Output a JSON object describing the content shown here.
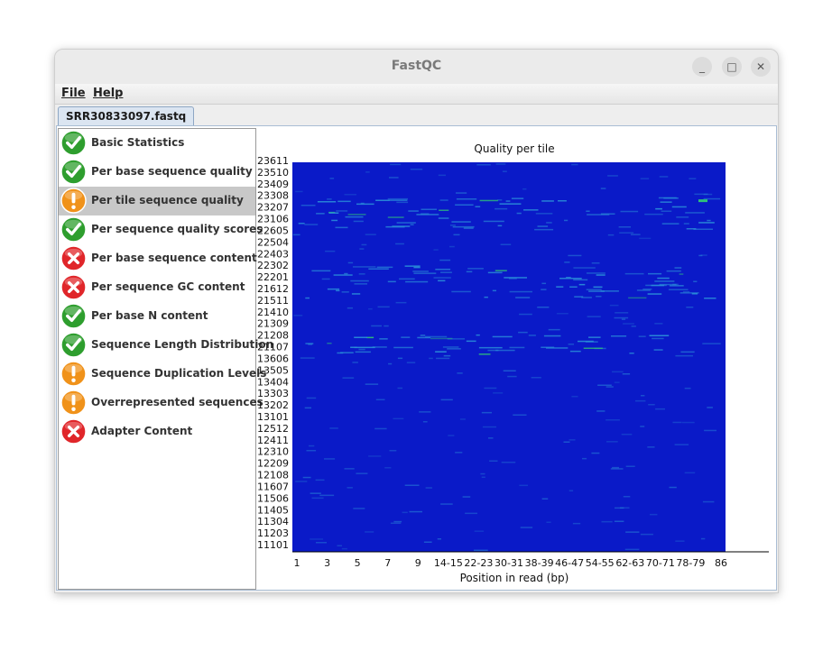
{
  "window": {
    "title": "FastQC",
    "controls": {
      "minimize": "_",
      "maximize": "□",
      "close": "✕"
    }
  },
  "menu": {
    "file": "File",
    "help": "Help"
  },
  "tab": {
    "label": "SRR30833097.fastq"
  },
  "modules": [
    {
      "label": "Basic Statistics",
      "status": "pass"
    },
    {
      "label": "Per base sequence quality",
      "status": "pass"
    },
    {
      "label": "Per tile sequence quality",
      "status": "warn",
      "selected": true
    },
    {
      "label": "Per sequence quality scores",
      "status": "pass"
    },
    {
      "label": "Per base sequence content",
      "status": "fail"
    },
    {
      "label": "Per sequence GC content",
      "status": "fail"
    },
    {
      "label": "Per base N content",
      "status": "pass"
    },
    {
      "label": "Sequence Length Distribution",
      "status": "pass"
    },
    {
      "label": "Sequence Duplication Levels",
      "status": "warn"
    },
    {
      "label": "Overrepresented sequences",
      "status": "warn"
    },
    {
      "label": "Adapter Content",
      "status": "fail"
    }
  ],
  "status_colors": {
    "pass": "#2e9e2e",
    "warn": "#f0921a",
    "fail": "#e0262a"
  },
  "chart_data": {
    "type": "heatmap",
    "title": "Quality per tile",
    "xlabel": "Position in read (bp)",
    "ylabel": "",
    "x_ticks": [
      "1",
      "3",
      "5",
      "7",
      "9",
      "14-15",
      "22-23",
      "30-31",
      "38-39",
      "46-47",
      "54-55",
      "62-63",
      "70-71",
      "78-79",
      "86"
    ],
    "y_ticks": [
      "23611",
      "23510",
      "23409",
      "23308",
      "23207",
      "23106",
      "22605",
      "22504",
      "22403",
      "22302",
      "22201",
      "21612",
      "21511",
      "21410",
      "21309",
      "21208",
      "21107",
      "13606",
      "13505",
      "13404",
      "13303",
      "13202",
      "13101",
      "12512",
      "12411",
      "12310",
      "12209",
      "12108",
      "11607",
      "11506",
      "11405",
      "11304",
      "11203",
      "11101"
    ],
    "base_color": "#0a1ac8",
    "hot_rows": [
      "23308",
      "23207",
      "23106",
      "22302",
      "22201",
      "21612",
      "21208",
      "21107"
    ],
    "colors": {
      "low": "#0a1ac8",
      "mid": "#2a8cd8",
      "high": "#2ec07a"
    }
  }
}
